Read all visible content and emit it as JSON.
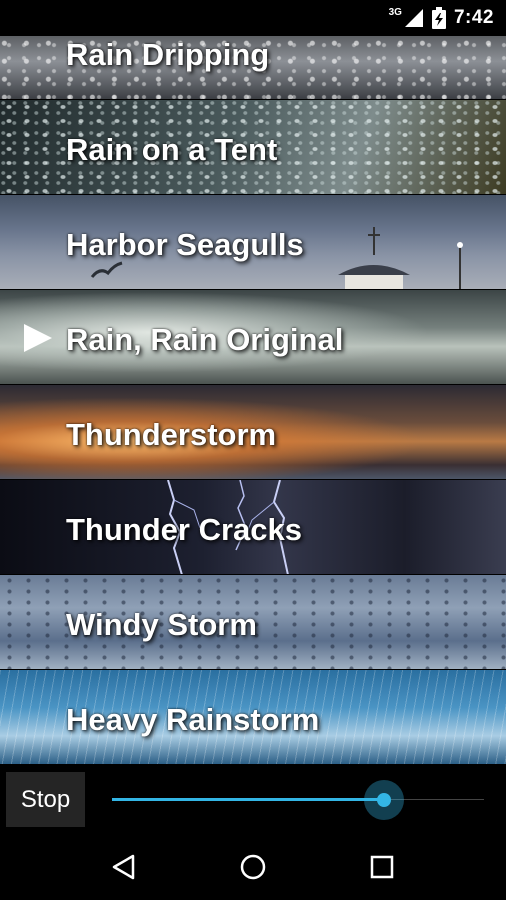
{
  "status_bar": {
    "network": "3G",
    "clock": "7:42",
    "icons": [
      "signal-icon",
      "battery-icon"
    ]
  },
  "sounds": [
    {
      "label": "Rain Dripping",
      "playing": false
    },
    {
      "label": "Rain on a Tent",
      "playing": false
    },
    {
      "label": "Harbor Seagulls",
      "playing": false
    },
    {
      "label": "Rain, Rain Original",
      "playing": true
    },
    {
      "label": "Thunderstorm",
      "playing": false
    },
    {
      "label": "Thunder Cracks",
      "playing": false
    },
    {
      "label": "Windy Storm",
      "playing": false
    },
    {
      "label": "Heavy Rainstorm",
      "playing": false
    }
  ],
  "controls": {
    "stop_label": "Stop",
    "volume_fraction": 0.73,
    "accent_color": "#33b5e5"
  },
  "nav": {
    "icons": [
      "back-icon",
      "home-icon",
      "recents-icon"
    ]
  }
}
